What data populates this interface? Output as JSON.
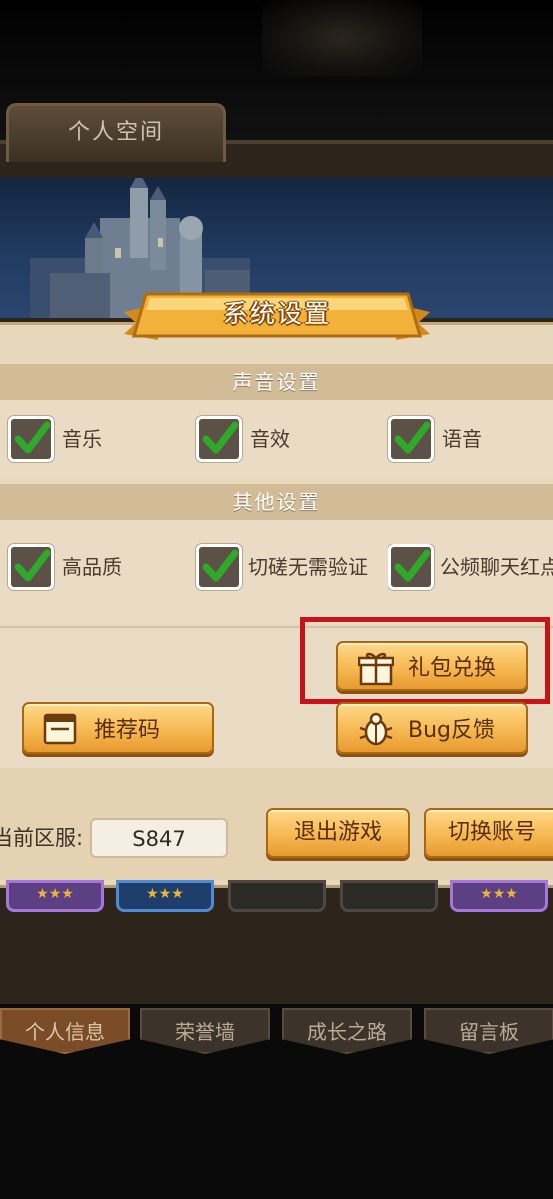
{
  "header": {
    "tab_label": "个人空间"
  },
  "dialog": {
    "title": "系统设置",
    "sound_section": {
      "title": "声音设置",
      "options": [
        {
          "label": "音乐",
          "checked": true
        },
        {
          "label": "音效",
          "checked": true
        },
        {
          "label": "语音",
          "checked": true
        }
      ]
    },
    "other_section": {
      "title": "其他设置",
      "options": [
        {
          "label": "高品质",
          "checked": true
        },
        {
          "label": "切磋无需验证",
          "checked": true
        },
        {
          "label": "公频聊天红点",
          "checked": true
        }
      ]
    },
    "buttons": {
      "gift_redeem": "礼包兑换",
      "referral_code": "推荐码",
      "bug_feedback": "Bug反馈",
      "exit_game": "退出游戏",
      "switch_account": "切换账号"
    },
    "server": {
      "label": "当前区服:",
      "value": "S847"
    }
  },
  "bottom_tabs": [
    {
      "label": "个人信息",
      "active": true
    },
    {
      "label": "荣誉墙",
      "active": false
    },
    {
      "label": "成长之路",
      "active": false
    },
    {
      "label": "留言板",
      "active": false
    }
  ],
  "colors": {
    "highlight_border": "#c8111a",
    "button_gold": "#f6b852",
    "check_green": "#2fa82c"
  },
  "icons": {
    "checkbox": "check-icon",
    "gift": "gift-icon",
    "referral": "document-icon",
    "bug": "bug-icon"
  }
}
